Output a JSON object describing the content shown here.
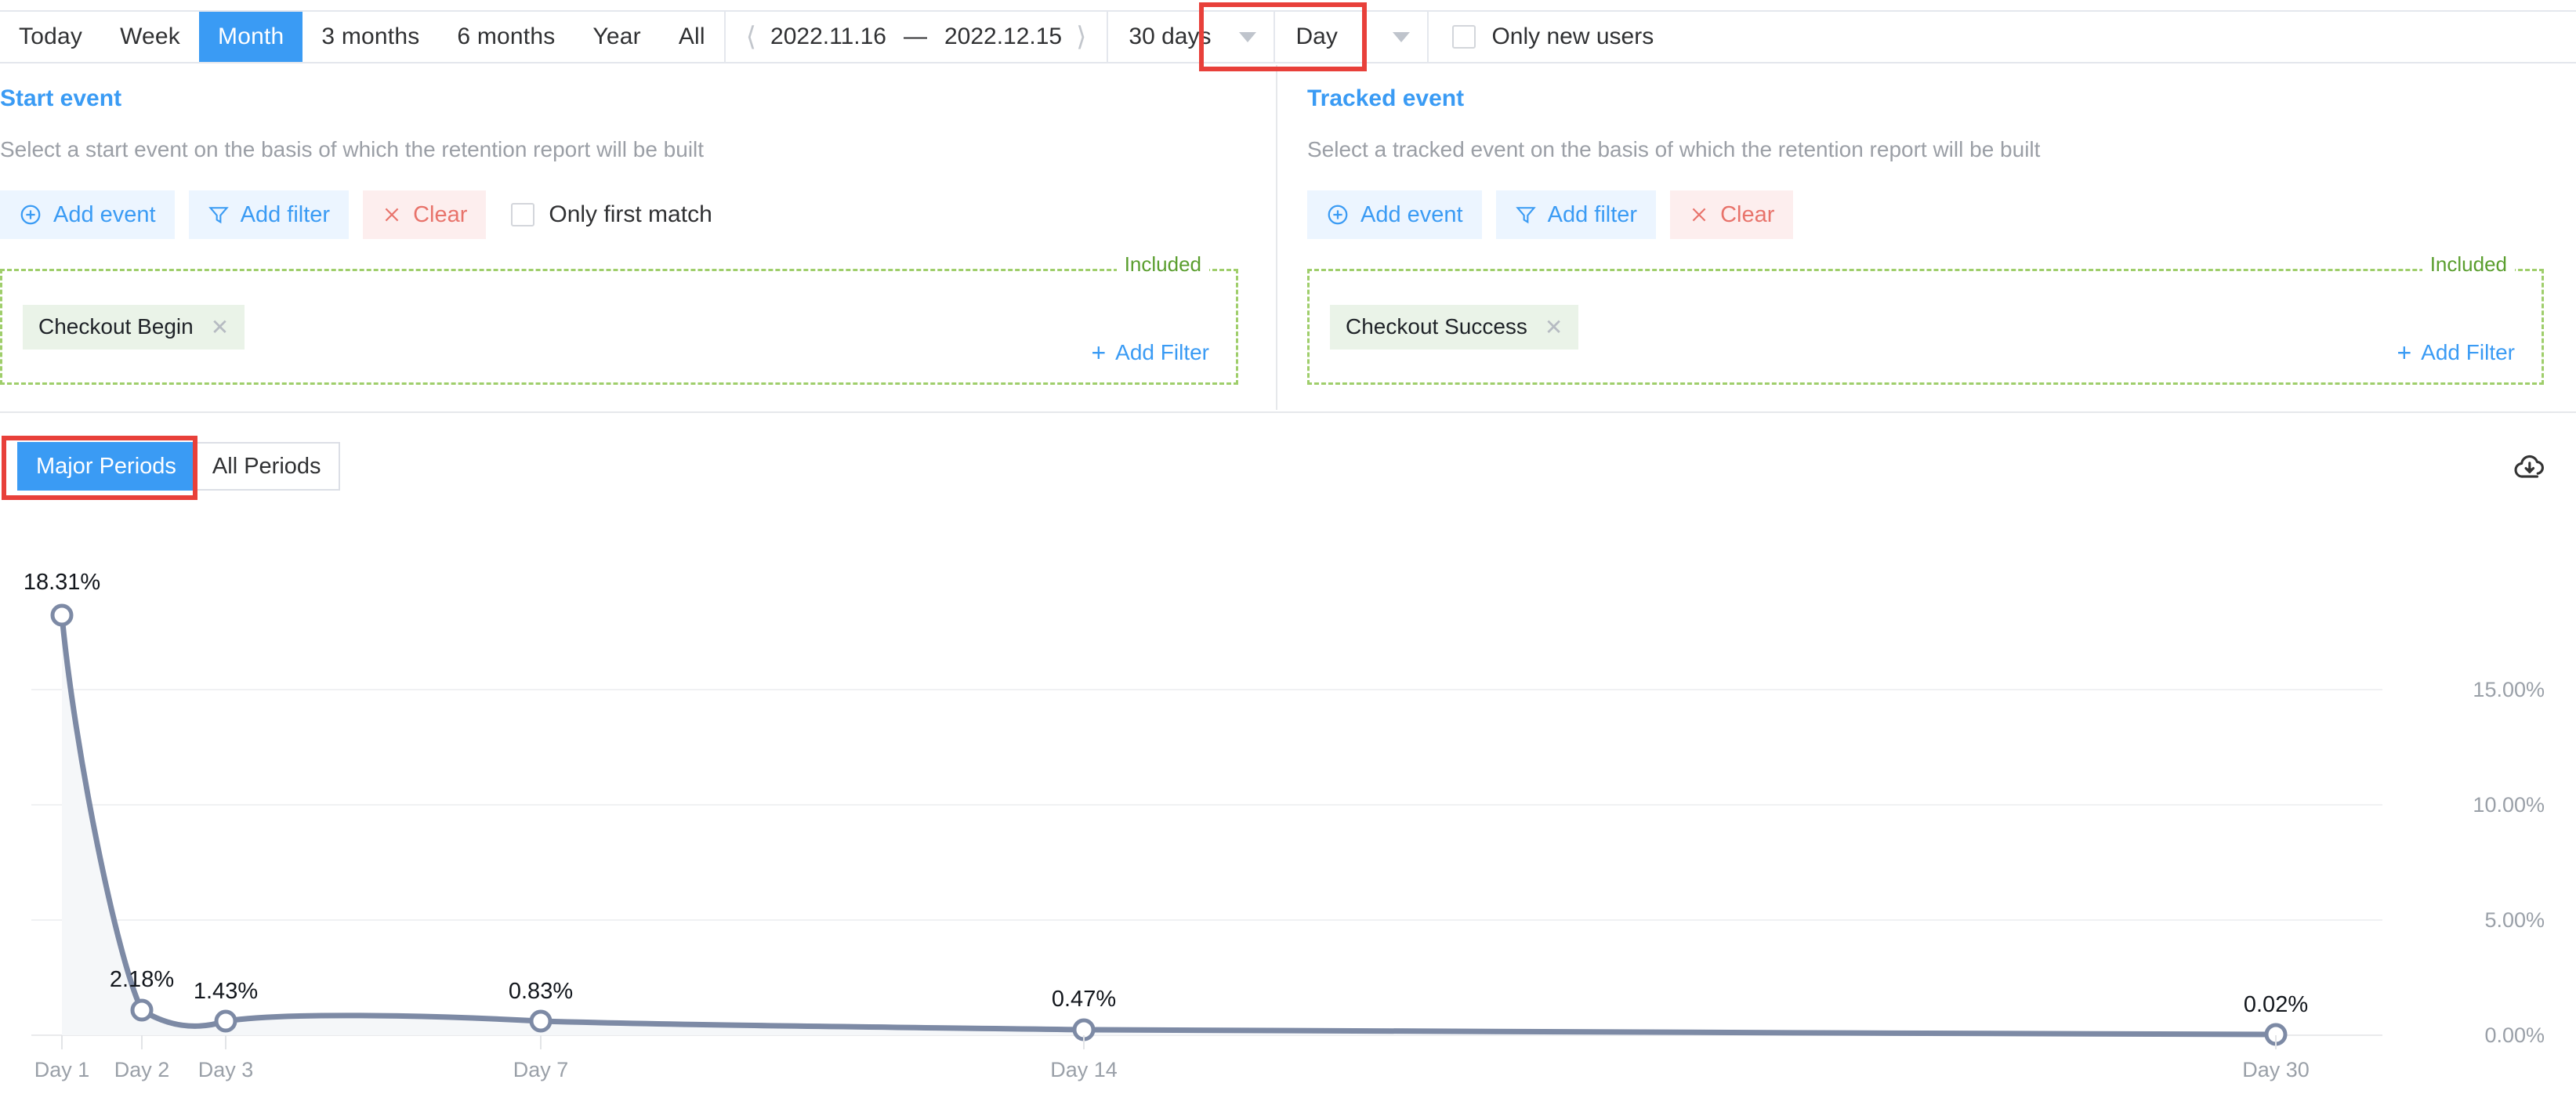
{
  "toolbar": {
    "ranges": [
      {
        "label": "Today",
        "active": false
      },
      {
        "label": "Week",
        "active": false
      },
      {
        "label": "Month",
        "active": true
      },
      {
        "label": "3 months",
        "active": false
      },
      {
        "label": "6 months",
        "active": false
      },
      {
        "label": "Year",
        "active": false
      },
      {
        "label": "All",
        "active": false
      }
    ],
    "date_prev_icon": "chevron-left-icon",
    "date_next_icon": "chevron-right-icon",
    "date_start": "2022.11.16",
    "date_dash": "—",
    "date_end": "2022.12.15",
    "window_select": "30 days",
    "granularity_select": "Day",
    "only_new_users_label": "Only new users",
    "only_new_users_checked": false,
    "highlight_color": "#e8403a",
    "accent_color": "#3a9bf4"
  },
  "start_event": {
    "title": "Start event",
    "subtitle": "Select a start event on the basis of which the retention report will be built",
    "add_event_label": "Add event",
    "add_filter_label": "Add filter",
    "clear_label": "Clear",
    "only_first_match_label": "Only first match",
    "only_first_match_checked": false,
    "included_label": "Included",
    "chip_label": "Checkout Begin",
    "add_filter_link": "Add Filter"
  },
  "tracked_event": {
    "title": "Tracked event",
    "subtitle": "Select a tracked event on the basis of which the retention report will be built",
    "add_event_label": "Add event",
    "add_filter_label": "Add filter",
    "clear_label": "Clear",
    "included_label": "Included",
    "chip_label": "Checkout Success",
    "add_filter_link": "Add Filter"
  },
  "chart_panel": {
    "tabs": [
      {
        "label": "Major Periods",
        "active": true
      },
      {
        "label": "All Periods",
        "active": false
      }
    ],
    "download_icon": "cloud-download-icon"
  },
  "chart_data": {
    "type": "line",
    "title": "",
    "xlabel": "",
    "ylabel": "",
    "categories": [
      "Day 1",
      "Day 2",
      "Day 3",
      "Day 7",
      "Day 14",
      "Day 30"
    ],
    "x_values": [
      1,
      2,
      3,
      7,
      14,
      30
    ],
    "values": [
      18.31,
      2.18,
      1.43,
      0.83,
      0.47,
      0.02
    ],
    "point_labels": [
      "18.31%",
      "2.18%",
      "1.43%",
      "0.83%",
      "0.47%",
      "0.02%"
    ],
    "ytick_labels": [
      "15.00%",
      "10.00%",
      "5.00%",
      "0.00%"
    ],
    "ytick_values": [
      15,
      10,
      5,
      0
    ],
    "ylim": [
      0,
      20
    ],
    "grid": true,
    "legend": false,
    "line_color": "#7d8aa5",
    "area_color": "#f4f6f9",
    "marker_fill": "#ffffff"
  }
}
